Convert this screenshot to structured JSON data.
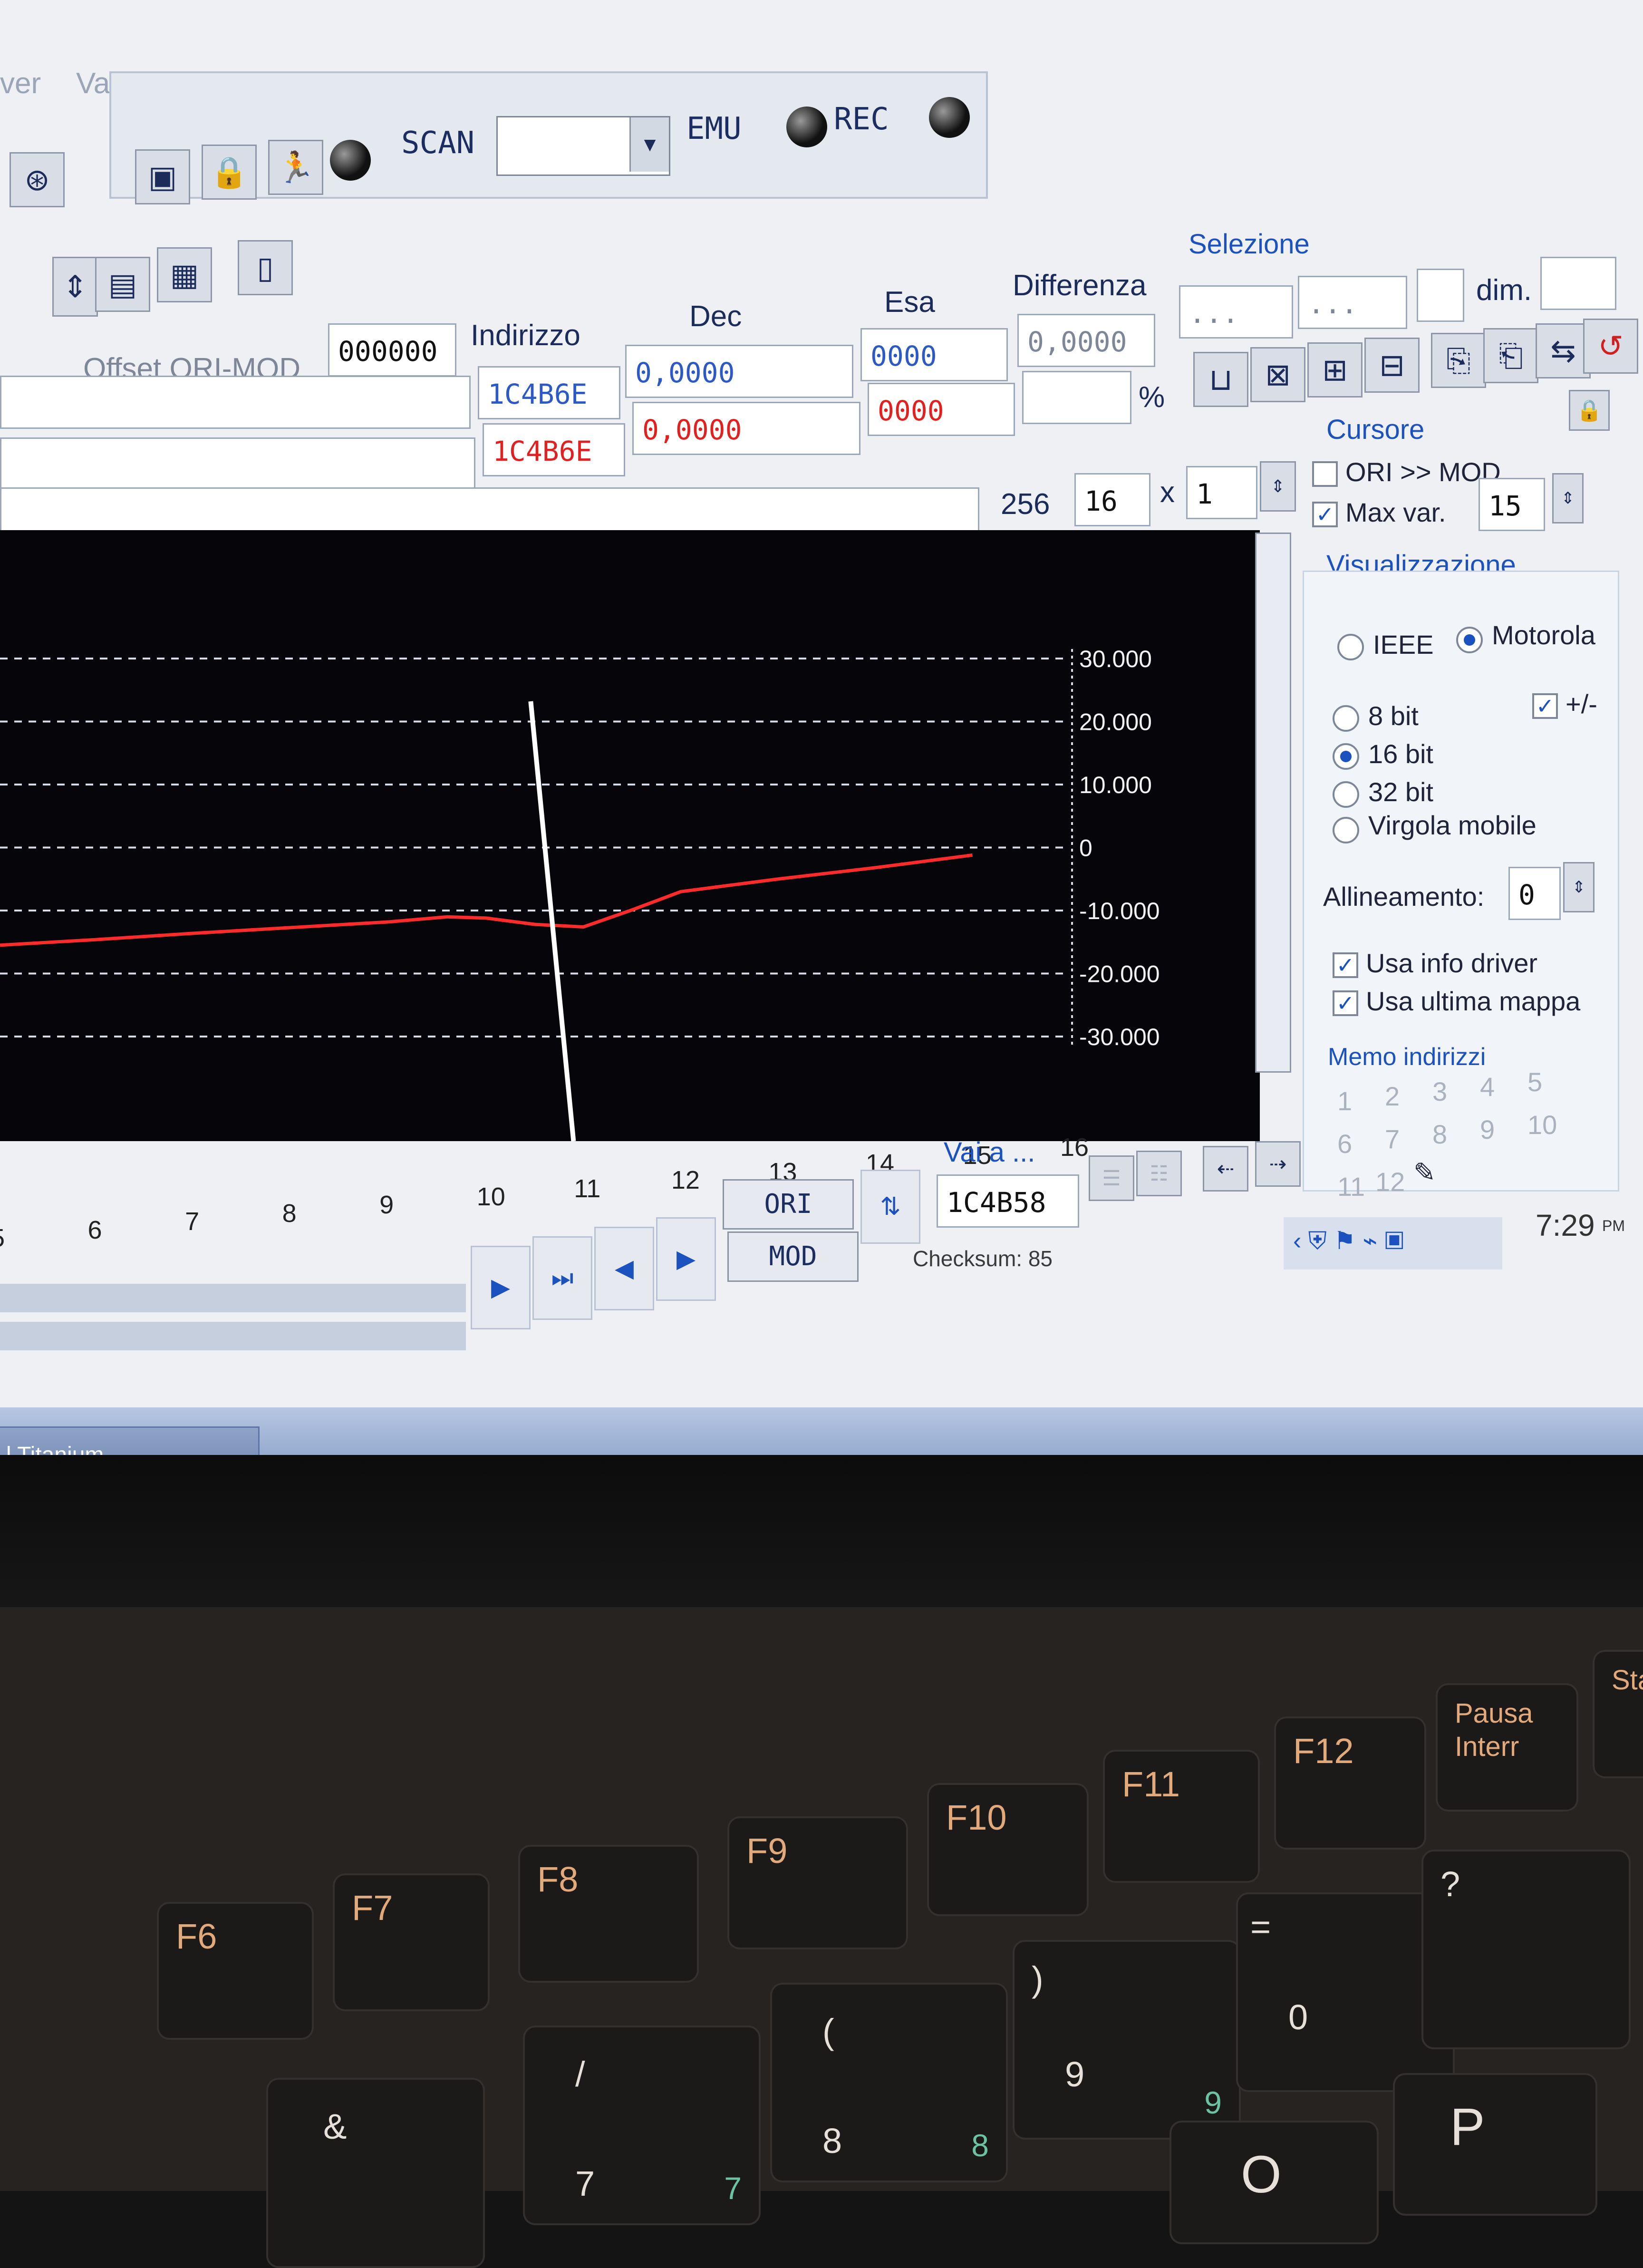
{
  "menu": {
    "items": [
      "ver",
      "Vai a ..."
    ]
  },
  "toolbar": {
    "scan_label": "SCAN",
    "emu_label": "EMU",
    "rec_label": "REC",
    "scan_combo_value": ""
  },
  "fields": {
    "offset_label": "Offset ORI-MOD",
    "offset_value": "000000",
    "indirizzo_header": "Indirizzo",
    "dec_header": "Dec",
    "esa_header": "Esa",
    "differenza_header": "Differenza",
    "percent": "%",
    "ori": {
      "indirizzo": "1C4B6E",
      "dec": "0,0000",
      "esa": "0000",
      "differenza": "0,0000"
    },
    "mod": {
      "indirizzo": "1C4B6E",
      "dec": "0,0000",
      "esa": "0000",
      "differenza": ""
    },
    "size_a": "256",
    "size_b": "16",
    "times": "x",
    "size_c": "1"
  },
  "selezione": {
    "title": "Selezione",
    "dim_label": "dim.",
    "field_a": "...",
    "field_b": "...",
    "field_c": "",
    "field_dim": ""
  },
  "cursore": {
    "title": "Cursore",
    "ori_mod_label": "ORI >> MOD",
    "ori_mod_checked": false,
    "max_var_label": "Max var.",
    "max_var_checked": true,
    "max_var_value": "15"
  },
  "visualizzazione": {
    "title": "Visualizzazione",
    "ieee_label": "IEEE",
    "motorola_label": "Motorola",
    "byte_order": "Motorola",
    "bit8_label": "8 bit",
    "bit16_label": "16 bit",
    "bit32_label": "32 bit",
    "float_label": "Virgola mobile",
    "selected_width": "16 bit",
    "signed_label": "+/-",
    "signed_checked": true,
    "allineamento_label": "Allineamento:",
    "allineamento_value": "0",
    "usa_info_driver_label": "Usa info driver",
    "usa_ultima_mappa_label": "Usa ultima mappa"
  },
  "memo": {
    "title": "Memo indirizzi",
    "slots": [
      "1",
      "2",
      "3",
      "4",
      "5",
      "6",
      "7",
      "8",
      "9",
      "10",
      "11",
      "12"
    ]
  },
  "navigation": {
    "ori_button": "ORI",
    "mod_button": "MOD",
    "vai_a_label": "Vai a ...",
    "vai_a_value": "1C4B58",
    "checksum": "Checksum: 85"
  },
  "taskbar": {
    "task_label": "l Titanium",
    "clock": "7:29",
    "clock_pm": "PM"
  },
  "keyboard": {
    "fkeys": [
      "F6",
      "F7",
      "F8",
      "F9",
      "F10",
      "F11",
      "F12"
    ],
    "pausa": "Pausa",
    "interr": "Interr",
    "sta": "Sta",
    "keys_row": [
      "&",
      "/",
      "(",
      ")",
      "=",
      "?"
    ],
    "digits": [
      "7",
      "8",
      "9",
      "0"
    ],
    "sub_digits": [
      "7",
      "8",
      "9"
    ],
    "letters": [
      "O",
      "P"
    ]
  },
  "chart_data": {
    "type": "line",
    "x": [
      5,
      6,
      7,
      8,
      9,
      9.6,
      10,
      10.5,
      11,
      11.5,
      12,
      12.5,
      13,
      13.5,
      14,
      14.5,
      15
    ],
    "x_tick_labels": [
      "5",
      "6",
      "7",
      "8",
      "9",
      "10",
      "11",
      "12",
      "13",
      "14",
      "15",
      "16"
    ],
    "y_tick_labels": [
      "30.000",
      "20.000",
      "10.000",
      "0",
      "-10.000",
      "-20.000",
      "-30.000"
    ],
    "ylim": [
      -30000,
      30000
    ],
    "series": [
      {
        "color": "#ff2b2b",
        "values": [
          -15500,
          -14600,
          -13600,
          -12700,
          -11800,
          -11000,
          -11200,
          -12200,
          -12600,
          -9900,
          -7000,
          -6000,
          -5000,
          -4100,
          -3200,
          -2200,
          -1200
        ]
      }
    ],
    "cursor_x": 10.8,
    "grid": true,
    "background": "#05050a"
  }
}
